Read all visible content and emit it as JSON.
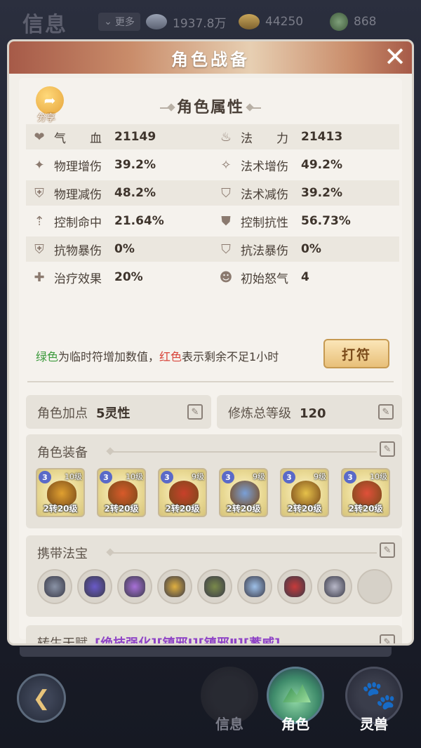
{
  "topbar": {
    "title": "信息",
    "more_label": "更多",
    "currencies": [
      {
        "icon": "silver-ingot-icon",
        "value": "1937.8万"
      },
      {
        "icon": "gold-ingot-icon",
        "value": "44250"
      },
      {
        "icon": "jade-coin-icon",
        "value": "868"
      }
    ]
  },
  "panel": {
    "title": "角色战备",
    "share_label": "分享",
    "attr_section_title": "角色属性",
    "attributes": [
      [
        {
          "icon": "heart-icon",
          "label": "气　　血",
          "value": "21149"
        },
        {
          "icon": "flame-icon",
          "label": "法　　力",
          "value": "21413"
        }
      ],
      [
        {
          "icon": "physical-boost-icon",
          "label": "物理增伤",
          "value": "39.2%"
        },
        {
          "icon": "magic-boost-icon",
          "label": "法术增伤",
          "value": "49.2%"
        }
      ],
      [
        {
          "icon": "physical-shield-icon",
          "label": "物理减伤",
          "value": "48.2%"
        },
        {
          "icon": "magic-shield-icon",
          "label": "法术减伤",
          "value": "39.2%"
        }
      ],
      [
        {
          "icon": "control-hit-icon",
          "label": "控制命中",
          "value": "21.64%"
        },
        {
          "icon": "control-resist-icon",
          "label": "控制抗性",
          "value": "56.73%"
        }
      ],
      [
        {
          "icon": "physical-crit-resist-icon",
          "label": "抗物暴伤",
          "value": "0%"
        },
        {
          "icon": "magic-crit-resist-icon",
          "label": "抗法暴伤",
          "value": "0%"
        }
      ],
      [
        {
          "icon": "heal-cross-icon",
          "label": "治疗效果",
          "value": "20%"
        },
        {
          "icon": "rage-face-icon",
          "label": "初始怒气",
          "value": "4"
        }
      ]
    ],
    "note": {
      "green": "绿色",
      "part1": "为临时符增加数值，",
      "red": "红色",
      "part2": "表示剩余不足1小时"
    },
    "dafu_label": "打符",
    "points": {
      "label": "角色加点",
      "value": "5灵性"
    },
    "cultivation": {
      "label": "修炼总等级",
      "value": "120"
    },
    "equipment": {
      "title": "角色装备",
      "items": [
        {
          "badge": "3",
          "level": "10级",
          "rank": "2转20级",
          "color": "#e0a030"
        },
        {
          "badge": "3",
          "level": "10级",
          "rank": "2转20级",
          "color": "#d85a2a"
        },
        {
          "badge": "3",
          "level": "9级",
          "rank": "2转20级",
          "color": "#c8402a"
        },
        {
          "badge": "3",
          "level": "9级",
          "rank": "2转20级",
          "color": "#7aa0d8"
        },
        {
          "badge": "3",
          "level": "9级",
          "rank": "2转20级",
          "color": "#e6c14a"
        },
        {
          "badge": "3",
          "level": "10级",
          "rank": "2转20级",
          "color": "#e0503a"
        }
      ]
    },
    "treasures": {
      "title": "携带法宝",
      "items": [
        {
          "color": "#8a93a6"
        },
        {
          "color": "#6a5ac8"
        },
        {
          "color": "#a870d8"
        },
        {
          "color": "#e0b040"
        },
        {
          "color": "#7a8a4a"
        },
        {
          "color": "#9ec0e8"
        },
        {
          "color": "#c83a3a"
        },
        {
          "color": "#b8b8c8"
        },
        {
          "color": ""
        }
      ]
    },
    "talent": {
      "label": "转生天赋",
      "value": "[绝技强化][镇邪Ⅰ][镇邪Ⅱ][蓄威]"
    }
  },
  "nav": {
    "items": [
      {
        "label": "信息",
        "color": "#4a4a50"
      },
      {
        "label": "角色",
        "color": "#5aa87a"
      },
      {
        "label": "灵兽",
        "color": "#d86a6a"
      }
    ]
  }
}
